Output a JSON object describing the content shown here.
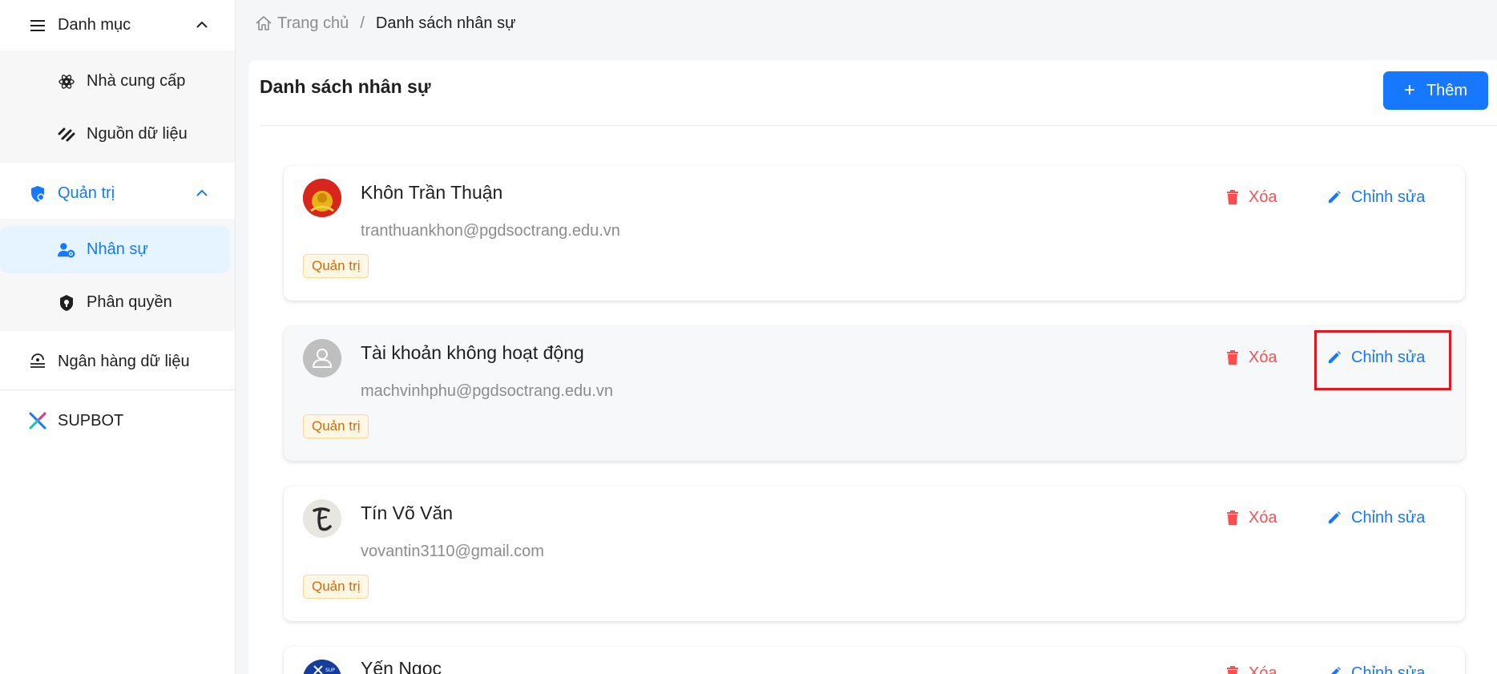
{
  "sidebar": {
    "group_danh_muc": {
      "label": "Danh mục",
      "icon": "menu-icon"
    },
    "danh_muc_items": [
      {
        "label": "Nhà cung cấp",
        "icon": "provider-icon"
      },
      {
        "label": "Nguồn dữ liệu",
        "icon": "data-source-icon"
      }
    ],
    "group_quan_tri": {
      "label": "Quản trị",
      "icon": "shield-icon"
    },
    "quan_tri_items": [
      {
        "label": "Nhân sự",
        "icon": "user-settings-icon",
        "active": true
      },
      {
        "label": "Phân quyền",
        "icon": "permission-icon"
      }
    ],
    "ngan_hang": {
      "label": "Ngân hàng dữ liệu",
      "icon": "data-bank-icon"
    },
    "supbot": {
      "label": "SUPBOT",
      "icon": "supbot-logo-icon"
    }
  },
  "breadcrumb": {
    "home": "Trang chủ",
    "separator": "/",
    "current": "Danh sách nhân sự"
  },
  "main": {
    "title": "Danh sách nhân sự",
    "add_button": {
      "icon": "+",
      "label": "Thêm"
    }
  },
  "users": [
    {
      "name": "Khôn Trần Thuận",
      "email": "tranthuankhon@pgdsoctrang.edu.vn",
      "role": "Quản trị",
      "delete_label": "Xóa",
      "edit_label": "Chỉnh sửa",
      "avatar": "red-emblem"
    },
    {
      "name": "Tài khoản không hoạt động",
      "email": "machvinhphu@pgdsoctrang.edu.vn",
      "role": "Quản trị",
      "delete_label": "Xóa",
      "edit_label": "Chỉnh sửa",
      "avatar": "default-user"
    },
    {
      "name": "Tín Võ Văn",
      "email": "vovantin3110@gmail.com",
      "role": "Quản trị",
      "delete_label": "Xóa",
      "edit_label": "Chỉnh sửa",
      "avatar": "calligraphy"
    },
    {
      "name": "Yến Ngọc",
      "email": "",
      "role": "",
      "delete_label": "Xóa",
      "edit_label": "Chỉnh sửa",
      "avatar": "blue-logo"
    }
  ],
  "colors": {
    "primary": "#1677ff",
    "danger": "#ff4d4f",
    "tag_text": "#d46b08",
    "tag_bg": "#fff7e6",
    "highlight": "#e8141c"
  }
}
